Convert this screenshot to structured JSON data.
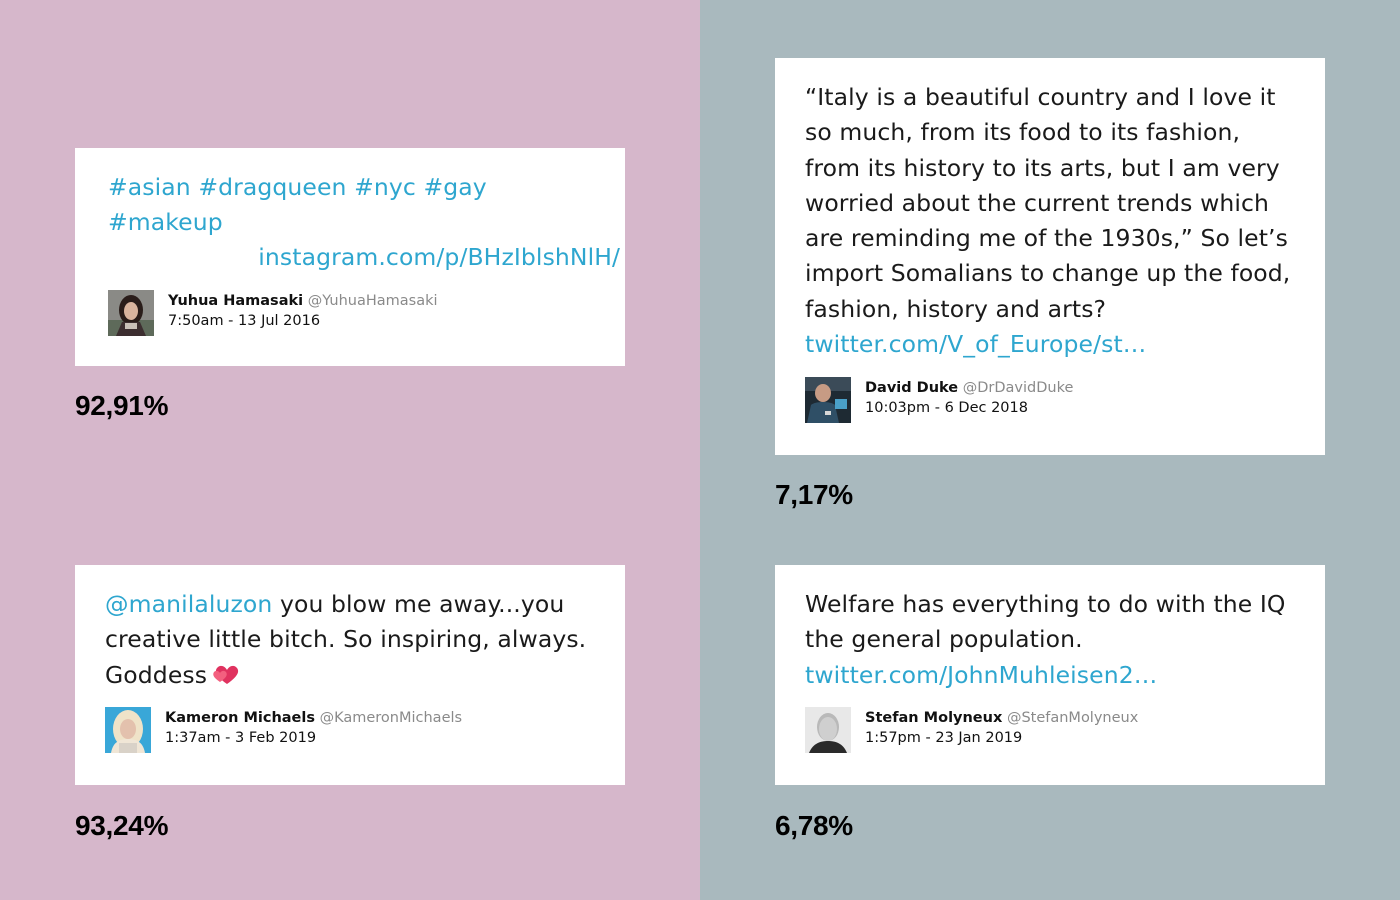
{
  "colors": {
    "left_bg": "#d6b7cb",
    "right_bg": "#a9b9be",
    "link": "#2ea6cf",
    "card": "#ffffff"
  },
  "tweets": [
    {
      "hashtags": "#asian #dragqueen #nyc #gay #makeup",
      "link": "instagram.com/p/BHzIblshNlH/",
      "name": "Yuhua Hamasaki",
      "handle": "@YuhuaHamasaki",
      "date": "7:50am - 13 Jul 2016",
      "percent": "92,91%",
      "avatar_icon": "drag-queen-portrait-avatar"
    },
    {
      "text": "“Italy is a beautiful country and I love it so much, from its food to its fashion, from its history to its arts, but I am very worried about the current trends which are reminding me of the 1930s,” So let’s import Somalians to change up the food, fashion, history and arts?",
      "link": "twitter.com/V_of_Europe/st…",
      "name": "David Duke",
      "handle": "@DrDavidDuke",
      "date": "10:03pm - 6 Dec 2018",
      "percent": "7,17%",
      "avatar_icon": "man-speaking-avatar"
    },
    {
      "mention": "@manilaluzon",
      "text": "you blow me away...you creative little bitch. So inspiring, always. Goddess",
      "emoji": "two-hearts-icon",
      "name": "Kameron Michaels",
      "handle": "@KameronMichaels",
      "date": "1:37am - 3 Feb 2019",
      "percent": "93,24%",
      "avatar_icon": "blonde-drag-queen-avatar"
    },
    {
      "text": "Welfare has everything to do with the IQ the general population.",
      "link": "twitter.com/JohnMuhleisen2…",
      "name": "Stefan Molyneux",
      "handle": "@StefanMolyneux",
      "date": "1:57pm - 23 Jan 2019",
      "percent": "6,78%",
      "avatar_icon": "bald-man-portrait-avatar"
    }
  ]
}
